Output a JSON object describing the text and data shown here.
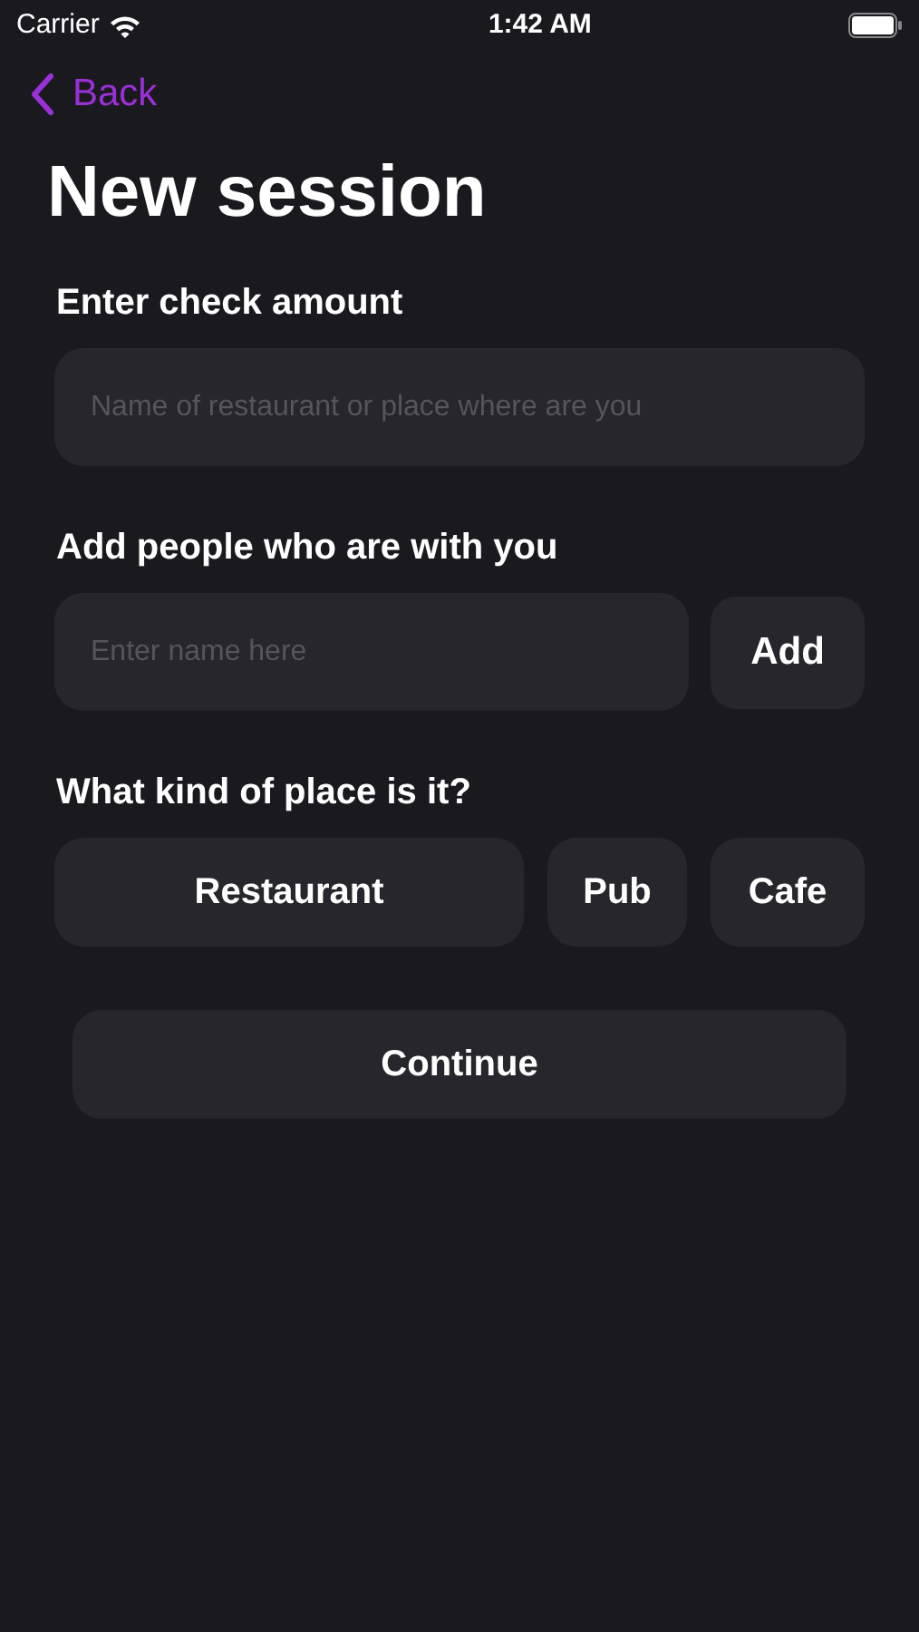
{
  "status_bar": {
    "carrier": "Carrier",
    "time": "1:42 AM"
  },
  "nav": {
    "back": "Back"
  },
  "title": "New session",
  "check_amount": {
    "label": "Enter check amount",
    "placeholder": "Name of restaurant or place where are you"
  },
  "people": {
    "label": "Add people who are with you",
    "placeholder": "Enter name here",
    "add_button": "Add"
  },
  "place_kind": {
    "label": "What kind of place is it?",
    "options": [
      {
        "label": "Restaurant"
      },
      {
        "label": "Pub"
      },
      {
        "label": "Cafe"
      }
    ]
  },
  "continue_button": "Continue"
}
